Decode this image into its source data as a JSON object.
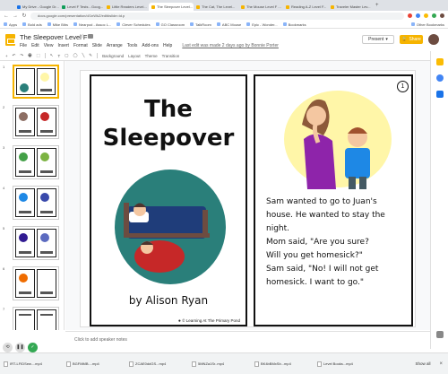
{
  "browser": {
    "tabs": [
      "My Drive - Google Dr...",
      "Level F Tests - Goog...",
      "Little Readers Level...",
      "The Sleepover Level...",
      "The Cat, The Level...",
      "The Mouse Level F ...",
      "Reading A-Z Level F...",
      "Traveler Master Lev..."
    ],
    "active_tab": 3,
    "url": "docs.google.com/presentation/d/1nWkZ/edit#slide=id.p",
    "bookmarks": [
      "Apps",
      "Bold ads",
      "Mike Bibs",
      "Nearpod - Assoc L...",
      "Clever Schedules",
      "GO Classroom",
      "TalkRoom",
      "ABC Mouse",
      "Epic - Wonder...",
      "Bookmarks",
      "Other Bookmarks"
    ]
  },
  "doc": {
    "title": "The Sleepover Level F",
    "menu": [
      "File",
      "Edit",
      "View",
      "Insert",
      "Format",
      "Slide",
      "Arrange",
      "Tools",
      "Add-ons",
      "Help"
    ],
    "last_edit": "Last edit was made 2 days ago by Bonnie Porter",
    "present_label": "Present",
    "share_label": "Share"
  },
  "toolbar": {
    "items": [
      "+",
      "↶",
      "↷",
      "🖶",
      "⬚",
      "↖",
      "T",
      "▢",
      "◯",
      "╲",
      "✎"
    ],
    "background": "Background",
    "layout": "Layout",
    "theme": "Theme",
    "transition": "Transition"
  },
  "filmstrip": {
    "numbers": [
      "1",
      "2",
      "3",
      "4",
      "5",
      "6",
      "7"
    ]
  },
  "slide": {
    "cover_title_line1": "The",
    "cover_title_line2": "Sleepover",
    "author": "by Alison Ryan",
    "credit": "© Learning At The Primary Pond",
    "page_number": "1",
    "story_lines": [
      "Sam wanted to go to Juan's",
      "house. He wanted to stay the",
      "night.",
      "Mom said, \"Are you sure?",
      "Will you get homesick?\"",
      "Sam said, \"No! I will not get",
      "homesick. I want to go.\""
    ]
  },
  "notes": {
    "placeholder": "Click to add speaker notes"
  },
  "downloads": {
    "files": [
      "IRT-LFIDSew....mp4",
      "BGFMMB....mp4",
      "ZCAE0ddGS...mp4",
      "5MNZa1Sr..mp4",
      "BK4bBMxSb...mp4",
      "Level Books...mp4"
    ],
    "show_all": "Show all"
  },
  "colors": {
    "accent": "#f6b400",
    "present_green": "#34a853"
  }
}
